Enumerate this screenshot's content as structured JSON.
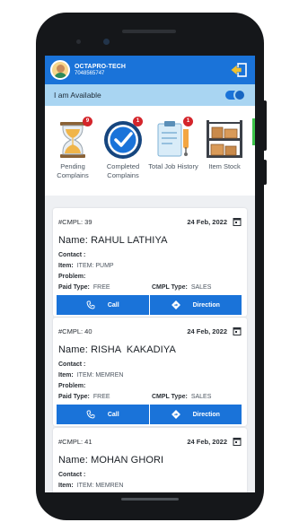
{
  "header": {
    "company_name": "OCTAPRO-TECH",
    "phone": "7048565747"
  },
  "availability": {
    "label": "I am Available",
    "enabled": true
  },
  "menu": [
    {
      "label": "Pending Complains",
      "badge": "9",
      "icon": "hourglass-icon"
    },
    {
      "label": "Completed Complains",
      "badge": "1",
      "icon": "checkmark-badge-icon"
    },
    {
      "label": "Total Job History",
      "badge": "1",
      "icon": "clipboard-icon"
    },
    {
      "label": "Item Stock",
      "badge": "",
      "icon": "shelves-boxes-icon"
    }
  ],
  "field_labels": {
    "name": "Name:",
    "contact": "Contact :",
    "item": "Item:",
    "problem": "Problem:",
    "paid_type": "Paid Type:",
    "cmpl_type": "CMPL Type:"
  },
  "actions": {
    "call": "Call",
    "direction": "Direction"
  },
  "complaints": [
    {
      "id": "#CMPL: 39",
      "date": "24 Feb, 2022",
      "name": "RAHUL LATHIYA",
      "contact": "",
      "item": "ITEM: PUMP",
      "problem": "",
      "paid_type": "FREE",
      "cmpl_type": "SALES"
    },
    {
      "id": "#CMPL: 40",
      "date": "24 Feb, 2022",
      "name": "RISHA  KAKADIYA",
      "contact": "",
      "item": "ITEM: MEMREN",
      "problem": "",
      "paid_type": "FREE",
      "cmpl_type": "SALES"
    },
    {
      "id": "#CMPL: 41",
      "date": "24 Feb, 2022",
      "name": "MOHAN GHORI",
      "contact": "",
      "item": "ITEM: MEMREN",
      "problem": "",
      "paid_type": "",
      "cmpl_type": ""
    }
  ],
  "colors": {
    "primary": "#1a73d9",
    "availability_bar": "#a9d5f2",
    "badge": "#d4252b"
  }
}
